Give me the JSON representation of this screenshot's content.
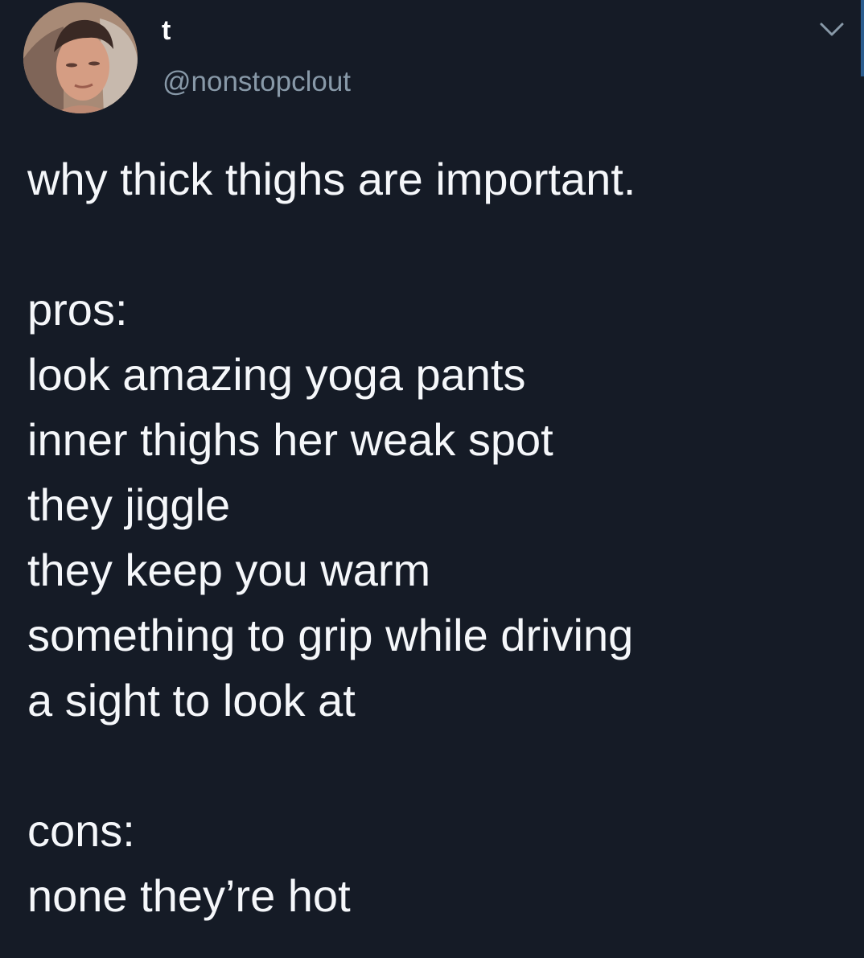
{
  "user": {
    "display_name": "t",
    "handle": "@nonstopclout",
    "avatar_icon": "profile-photo"
  },
  "menu": {
    "caret_icon": "chevron-down-icon"
  },
  "tweet": {
    "title_line": "why thick thighs are important.",
    "pros_header": "pros:",
    "pros": [
      "look amazing yoga pants",
      "inner thighs her weak spot",
      "they jiggle",
      "they keep you warm",
      "something to grip while driving",
      "a sight to look at"
    ],
    "cons_header": "cons:",
    "cons": [
      "none they’re hot"
    ]
  },
  "colors": {
    "background": "#151b26",
    "text": "#f5f7fa",
    "handle": "#8899a8"
  }
}
